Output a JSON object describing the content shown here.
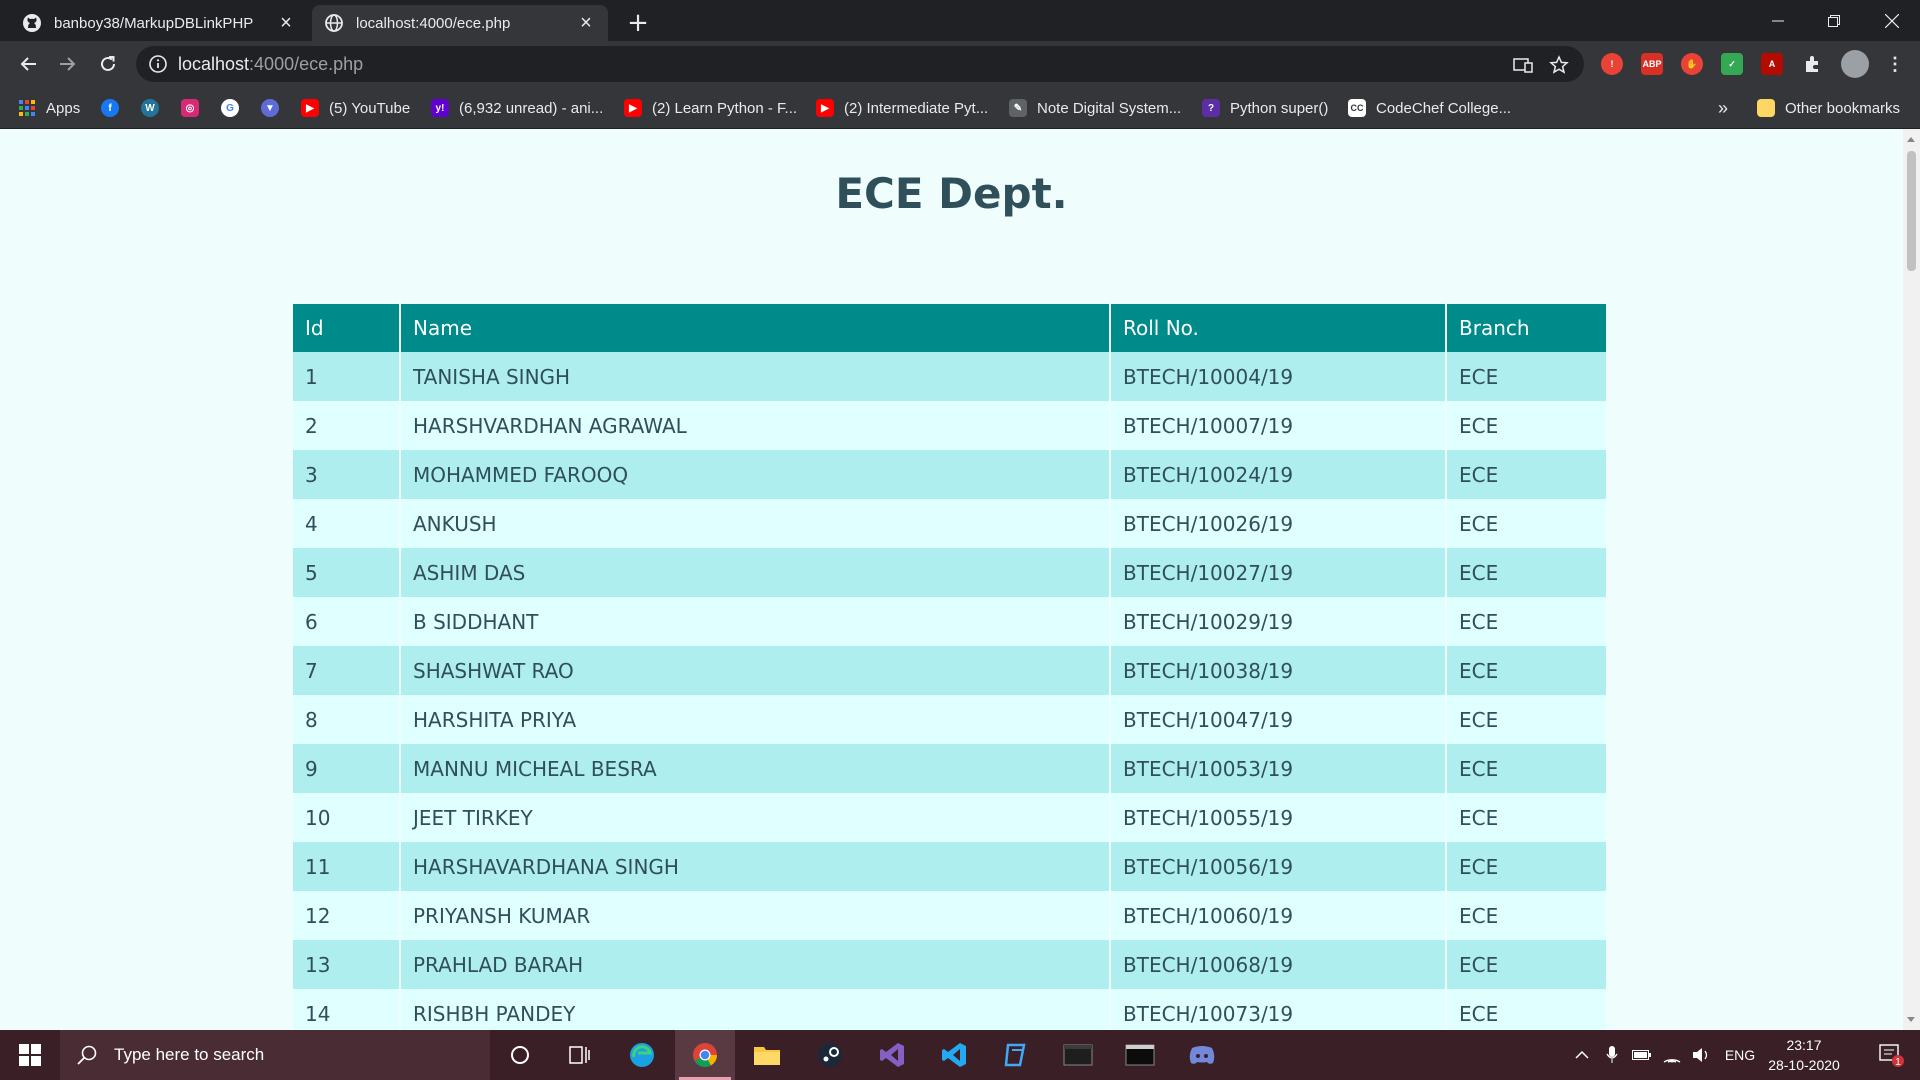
{
  "browser": {
    "tabs": [
      {
        "title": "banboy38/MarkupDBLinkPHP",
        "icon": "github-icon",
        "active": false
      },
      {
        "title": "localhost:4000/ece.php",
        "icon": "globe-icon",
        "active": true
      }
    ],
    "address": {
      "host": "localhost",
      "path": ":4000/ece.php"
    },
    "bookmarks": [
      {
        "label": "Apps",
        "icon": "apps-grid-icon"
      },
      {
        "label": "",
        "icon": "facebook-icon"
      },
      {
        "label": "",
        "icon": "wordpress-icon"
      },
      {
        "label": "",
        "icon": "instagram-icon"
      },
      {
        "label": "",
        "icon": "google-icon"
      },
      {
        "label": "",
        "icon": "shield-bookmark-icon"
      },
      {
        "label": "(5) YouTube",
        "icon": "youtube-icon"
      },
      {
        "label": "(6,932 unread) - ani...",
        "icon": "yahoo-mail-icon"
      },
      {
        "label": "(2) Learn Python - F...",
        "icon": "youtube-icon"
      },
      {
        "label": "(2) Intermediate Pyt...",
        "icon": "youtube-icon"
      },
      {
        "label": "Note Digital System...",
        "icon": "note-icon"
      },
      {
        "label": "Python super()",
        "icon": "python-bookmark-icon"
      },
      {
        "label": "CodeChef College...",
        "icon": "codechef-icon"
      }
    ],
    "bookmarks_overflow": "»",
    "other_bookmarks": "Other bookmarks",
    "extensions": {
      "abp_label": "ABP"
    }
  },
  "page": {
    "title": "ECE Dept.",
    "table": {
      "headers": [
        "Id",
        "Name",
        "Roll No.",
        "Branch"
      ],
      "rows": [
        [
          "1",
          "TANISHA SINGH",
          "BTECH/10004/19",
          "ECE"
        ],
        [
          "2",
          "HARSHVARDHAN AGRAWAL",
          "BTECH/10007/19",
          "ECE"
        ],
        [
          "3",
          "MOHAMMED FAROOQ",
          "BTECH/10024/19",
          "ECE"
        ],
        [
          "4",
          "ANKUSH",
          "BTECH/10026/19",
          "ECE"
        ],
        [
          "5",
          "ASHIM DAS",
          "BTECH/10027/19",
          "ECE"
        ],
        [
          "6",
          "B SIDDHANT",
          "BTECH/10029/19",
          "ECE"
        ],
        [
          "7",
          "SHASHWAT RAO",
          "BTECH/10038/19",
          "ECE"
        ],
        [
          "8",
          "HARSHITA PRIYA",
          "BTECH/10047/19",
          "ECE"
        ],
        [
          "9",
          "MANNU MICHEAL BESRA",
          "BTECH/10053/19",
          "ECE"
        ],
        [
          "10",
          "JEET TIRKEY",
          "BTECH/10055/19",
          "ECE"
        ],
        [
          "11",
          "HARSHAVARDHANA SINGH",
          "BTECH/10056/19",
          "ECE"
        ],
        [
          "12",
          "PRIYANSH KUMAR",
          "BTECH/10060/19",
          "ECE"
        ],
        [
          "13",
          "PRAHLAD BARAH",
          "BTECH/10068/19",
          "ECE"
        ],
        [
          "14",
          "RISHBH PANDEY",
          "BTECH/10073/19",
          "ECE"
        ]
      ]
    },
    "colors": {
      "background": "#f0fdfd",
      "header": "#008b8b",
      "row_odd": "#afeeee",
      "row_even": "#e0ffff",
      "text": "#2f4f5a"
    }
  },
  "taskbar": {
    "search_placeholder": "Type here to search",
    "language": "ENG",
    "time": "23:17",
    "date": "28-10-2020",
    "notification_count": "1"
  }
}
